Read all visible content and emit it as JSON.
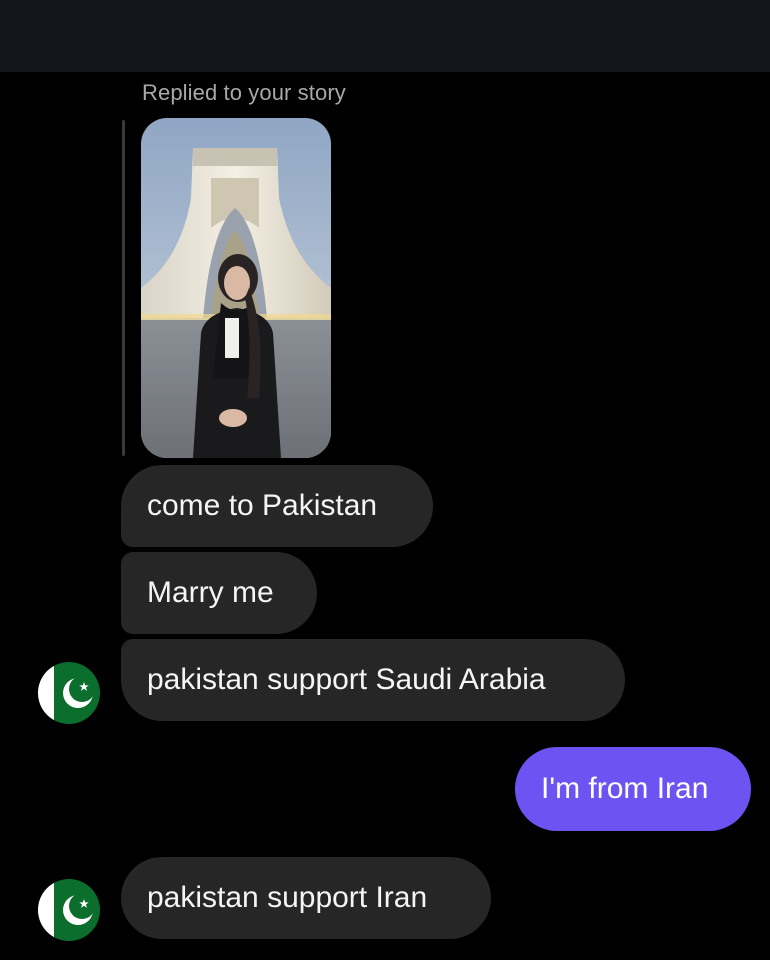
{
  "story_reply": {
    "label": "Replied to your story"
  },
  "messages": [
    {
      "text": "come to Pakistan",
      "from": "them"
    },
    {
      "text": "Marry me",
      "from": "them"
    },
    {
      "text": "pakistan support Saudi Arabia",
      "from": "them"
    },
    {
      "text": "I'm from Iran",
      "from": "me"
    },
    {
      "text": "pakistan support Iran",
      "from": "them"
    }
  ],
  "avatar_icon": "pakistan-flag-icon",
  "colors": {
    "background": "#000000",
    "incoming_bubble": "#262626",
    "outgoing_bubble": "#6d54f2",
    "flag_green": "#0b6e2c"
  }
}
